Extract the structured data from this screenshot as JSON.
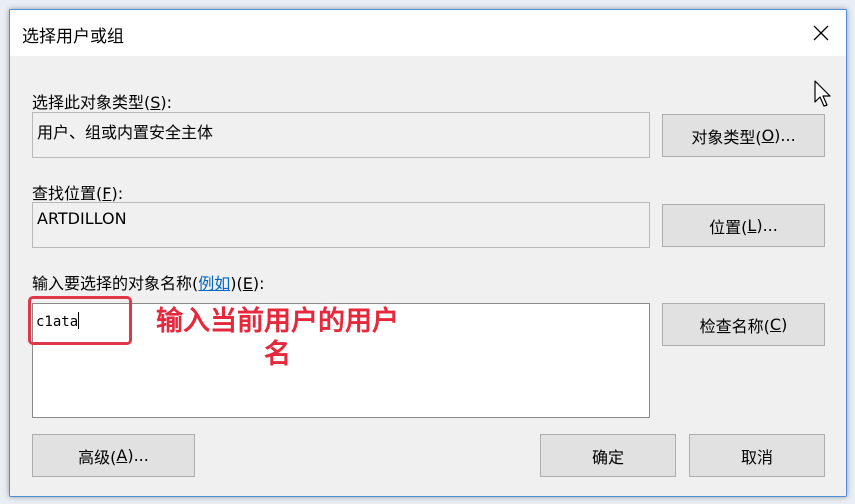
{
  "window": {
    "title": "选择用户或组"
  },
  "object_types": {
    "label_prefix": "选择此对象类型(",
    "label_key": "S",
    "label_suffix": "):",
    "value": "用户、组或内置安全主体",
    "button_prefix": "对象类型(",
    "button_key": "O",
    "button_suffix": ")..."
  },
  "location": {
    "label_prefix": "查找位置(",
    "label_key": "F",
    "label_suffix": "):",
    "value": "ARTDILLON",
    "button_prefix": "位置(",
    "button_key": "L",
    "button_suffix": ")..."
  },
  "names": {
    "label_prefix": "输入要选择的对象名称(",
    "examples_link": "例如",
    "label_mid": ")(",
    "label_key": "E",
    "label_suffix": "):",
    "value": "c1ata",
    "check_prefix": "检查名称(",
    "check_key": "C",
    "check_suffix": ")"
  },
  "footer": {
    "advanced_prefix": "高级(",
    "advanced_key": "A",
    "advanced_suffix": ")...",
    "ok": "确定",
    "cancel": "取消"
  },
  "annotation": {
    "line1": "输入当前用户的用户",
    "line2": "名",
    "color": "#e5283b"
  },
  "icons": {
    "close": "close-icon",
    "cursor": "mouse-pointer-icon"
  }
}
